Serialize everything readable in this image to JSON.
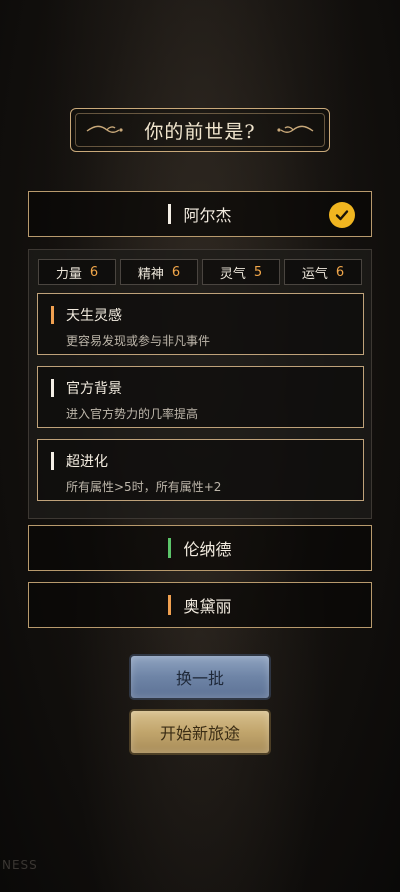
{
  "header": {
    "title": "你的前世是?"
  },
  "candidates": [
    {
      "name": "阿尔杰",
      "bar_color": "#f4efe6",
      "selected": true
    },
    {
      "name": "伦纳德",
      "bar_color": "#5cc46a",
      "selected": false
    },
    {
      "name": "奥黛丽",
      "bar_color": "#f0a050",
      "selected": false
    }
  ],
  "stats": [
    {
      "label": "力量",
      "value": "6"
    },
    {
      "label": "精神",
      "value": "6"
    },
    {
      "label": "灵气",
      "value": "5"
    },
    {
      "label": "运气",
      "value": "6"
    }
  ],
  "traits": [
    {
      "title": "天生灵感",
      "desc": "更容易发现或参与非凡事件",
      "bar_color": "#f0a050"
    },
    {
      "title": "官方背景",
      "desc": "进入官方势力的几率提高",
      "bar_color": "#f4efe6"
    },
    {
      "title": "超进化",
      "desc": "所有属性>5时，所有属性+2",
      "bar_color": "#f4efe6"
    }
  ],
  "buttons": {
    "refresh_label": "换一批",
    "start_label": "开始新旅途"
  },
  "watermark": "NESS",
  "colors": {
    "accent_gold": "#c9a97a",
    "check_yellow": "#f0b520",
    "stat_value": "#f0a64a"
  }
}
